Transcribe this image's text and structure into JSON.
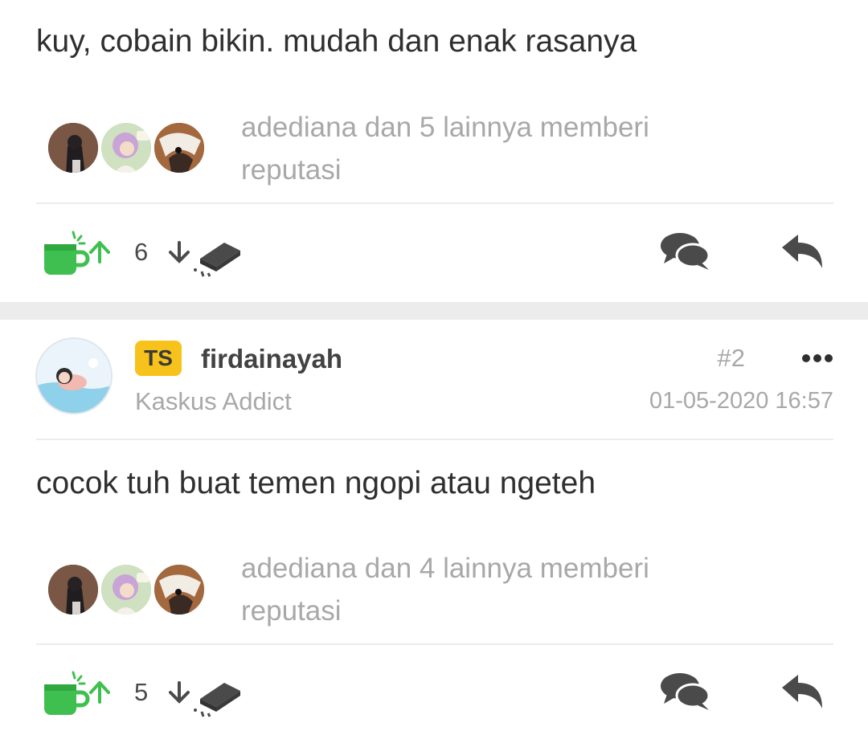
{
  "post1": {
    "text": "kuy, cobain bikin. mudah dan enak rasanya",
    "reputation_text": "adediana dan 5 lainnya memberi reputasi",
    "vote_count": "6"
  },
  "post2": {
    "ts_badge": "TS",
    "username": "firdainayah",
    "rank": "Kaskus Addict",
    "post_number": "#2",
    "date": "01-05-2020 16:57",
    "text": "cocok tuh buat temen ngopi atau ngeteh",
    "reputation_text": "adediana dan 4 lainnya memberi reputasi",
    "vote_count": "5"
  },
  "icons": {
    "upvote": "green-cup-up-arrow-icon",
    "downvote": "down-arrow-brick-icon",
    "quote": "chat-bubbles-icon",
    "reply": "reply-arrow-icon",
    "more": "more-dots-icon"
  },
  "colors": {
    "upvote_green": "#3fbf4f",
    "ts_badge": "#f7c21b",
    "muted_text": "#a8a8a8",
    "icon_dark": "#4a4a4a"
  }
}
